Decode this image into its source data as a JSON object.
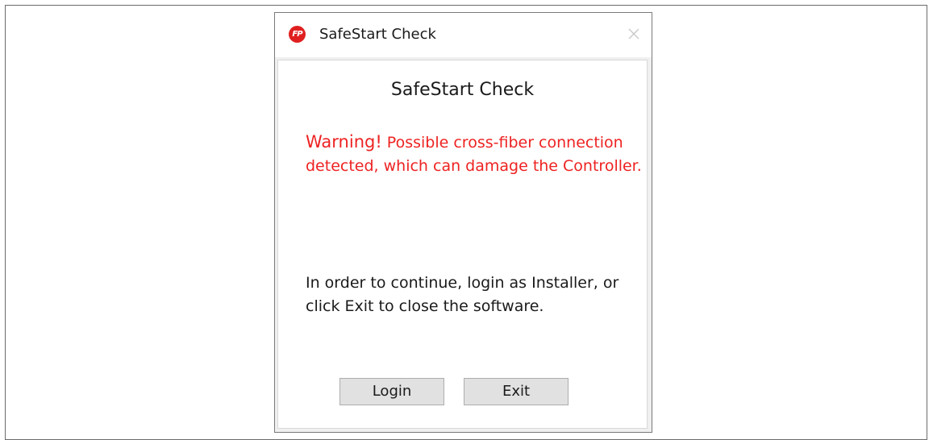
{
  "window": {
    "logo_text": "FP",
    "title": "SafeStart Check"
  },
  "content": {
    "heading": "SafeStart Check",
    "warning_label": "Warning!",
    "warning_text": " Possible cross-fiber connection detected, which can damage the Controller.",
    "instruction": "In order to continue, login as Installer, or click Exit to close the software."
  },
  "buttons": {
    "login": "Login",
    "exit": "Exit"
  },
  "icons": {
    "close": "close-icon",
    "logo": "app-logo-icon"
  },
  "colors": {
    "warning": "#ee2222",
    "logo": "#e02020"
  }
}
